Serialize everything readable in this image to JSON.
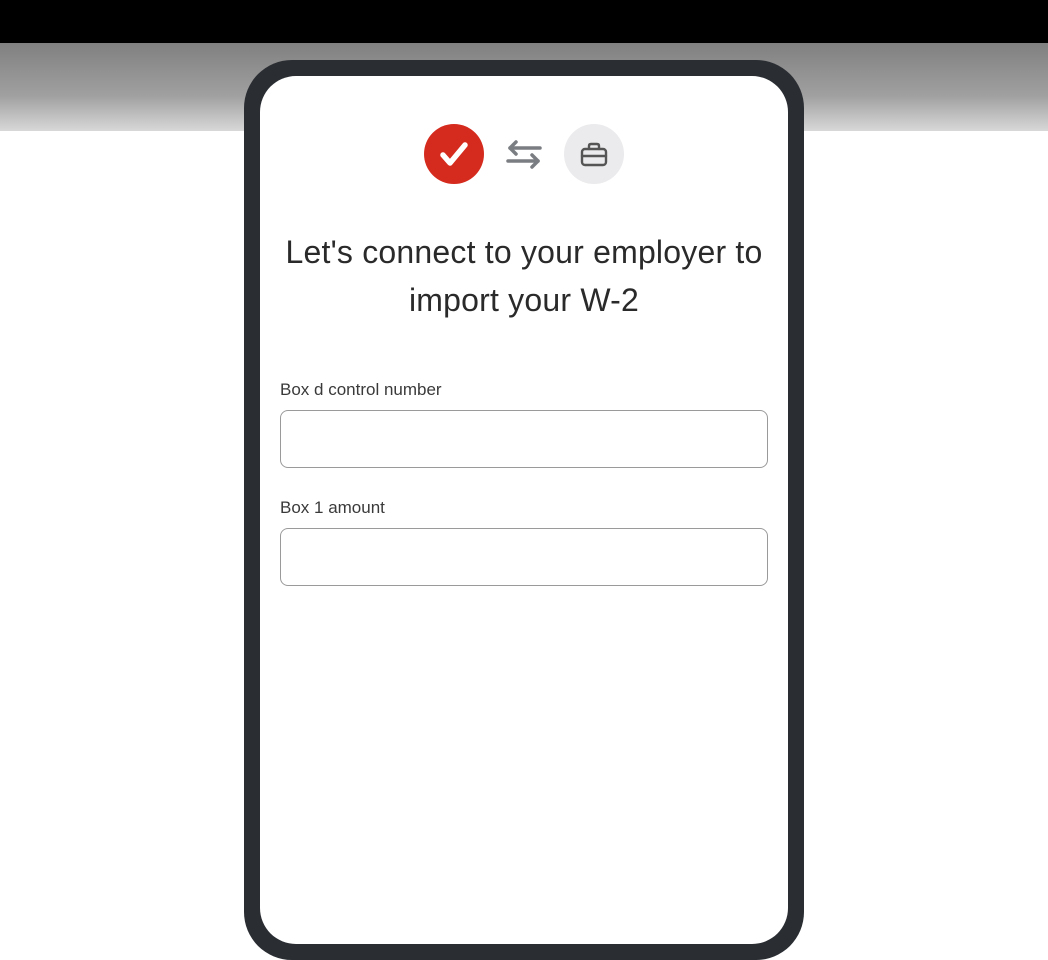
{
  "header": {
    "app_icon": "checkmark-circle",
    "connection_icon": "sync-arrows",
    "employer_icon": "briefcase"
  },
  "heading": "Let's connect to your employer to import your W-2",
  "form": {
    "fields": [
      {
        "label": "Box d control number",
        "value": ""
      },
      {
        "label": "Box 1 amount",
        "value": ""
      }
    ]
  }
}
